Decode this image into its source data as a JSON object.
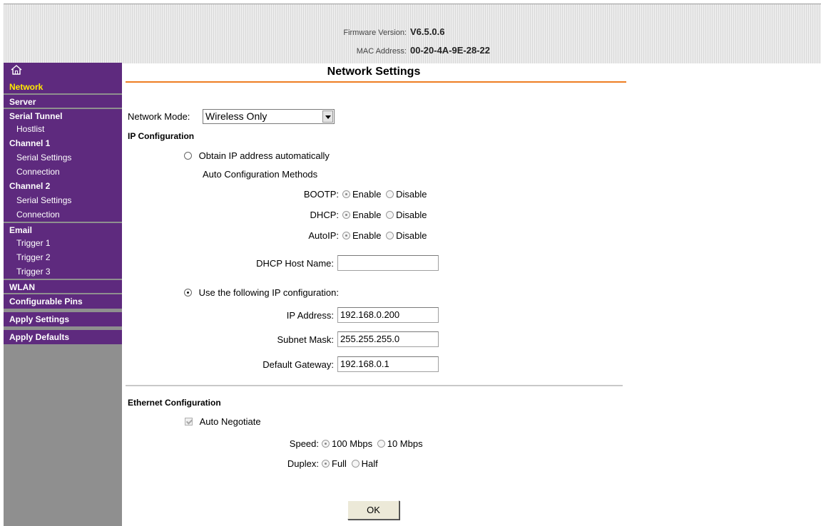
{
  "header": {
    "firmware_label": "Firmware Version:",
    "firmware_value": "V6.5.0.6",
    "mac_label": "MAC Address:",
    "mac_value": "00-20-4A-9E-28-22"
  },
  "sidebar": {
    "home_icon": "home-icon",
    "items": {
      "network": "Network",
      "server": "Server",
      "serial_tunnel": "Serial Tunnel",
      "hostlist": "Hostlist",
      "channel1": "Channel 1",
      "ch1_serial": "Serial Settings",
      "ch1_connection": "Connection",
      "channel2": "Channel 2",
      "ch2_serial": "Serial Settings",
      "ch2_connection": "Connection",
      "email": "Email",
      "trigger1": "Trigger 1",
      "trigger2": "Trigger 2",
      "trigger3": "Trigger 3",
      "wlan": "WLAN",
      "configurable_pins": "Configurable Pins",
      "apply_settings": "Apply Settings",
      "apply_defaults": "Apply Defaults"
    }
  },
  "main": {
    "title": "Network Settings",
    "network_mode_label": "Network Mode:",
    "network_mode_value": "Wireless Only",
    "ip_config_heading": "IP Configuration",
    "obtain_auto_label": "Obtain IP address automatically",
    "auto_methods_label": "Auto Configuration Methods",
    "bootp_label": "BOOTP:",
    "dhcp_label": "DHCP:",
    "autoip_label": "AutoIP:",
    "enable_label": "Enable",
    "disable_label": "Disable",
    "dhcp_host_label": "DHCP Host Name:",
    "dhcp_host_value": "",
    "use_following_label": "Use the following IP configuration:",
    "ip_address_label": "IP Address:",
    "ip_address_value": "192.168.0.200",
    "subnet_mask_label": "Subnet Mask:",
    "subnet_mask_value": "255.255.255.0",
    "gateway_label": "Default Gateway:",
    "gateway_value": "192.168.0.1",
    "ethernet_heading": "Ethernet Configuration",
    "auto_negotiate_label": "Auto Negotiate",
    "speed_label": "Speed:",
    "speed_100": "100 Mbps",
    "speed_10": "10 Mbps",
    "duplex_label": "Duplex:",
    "duplex_full": "Full",
    "duplex_half": "Half",
    "ok_label": "OK"
  },
  "colors": {
    "sidebar_purple": "#5e2a7e",
    "active_yellow": "#ffea00",
    "title_underline": "#ee7d22",
    "sidebar_gray": "#8f8f8f"
  }
}
